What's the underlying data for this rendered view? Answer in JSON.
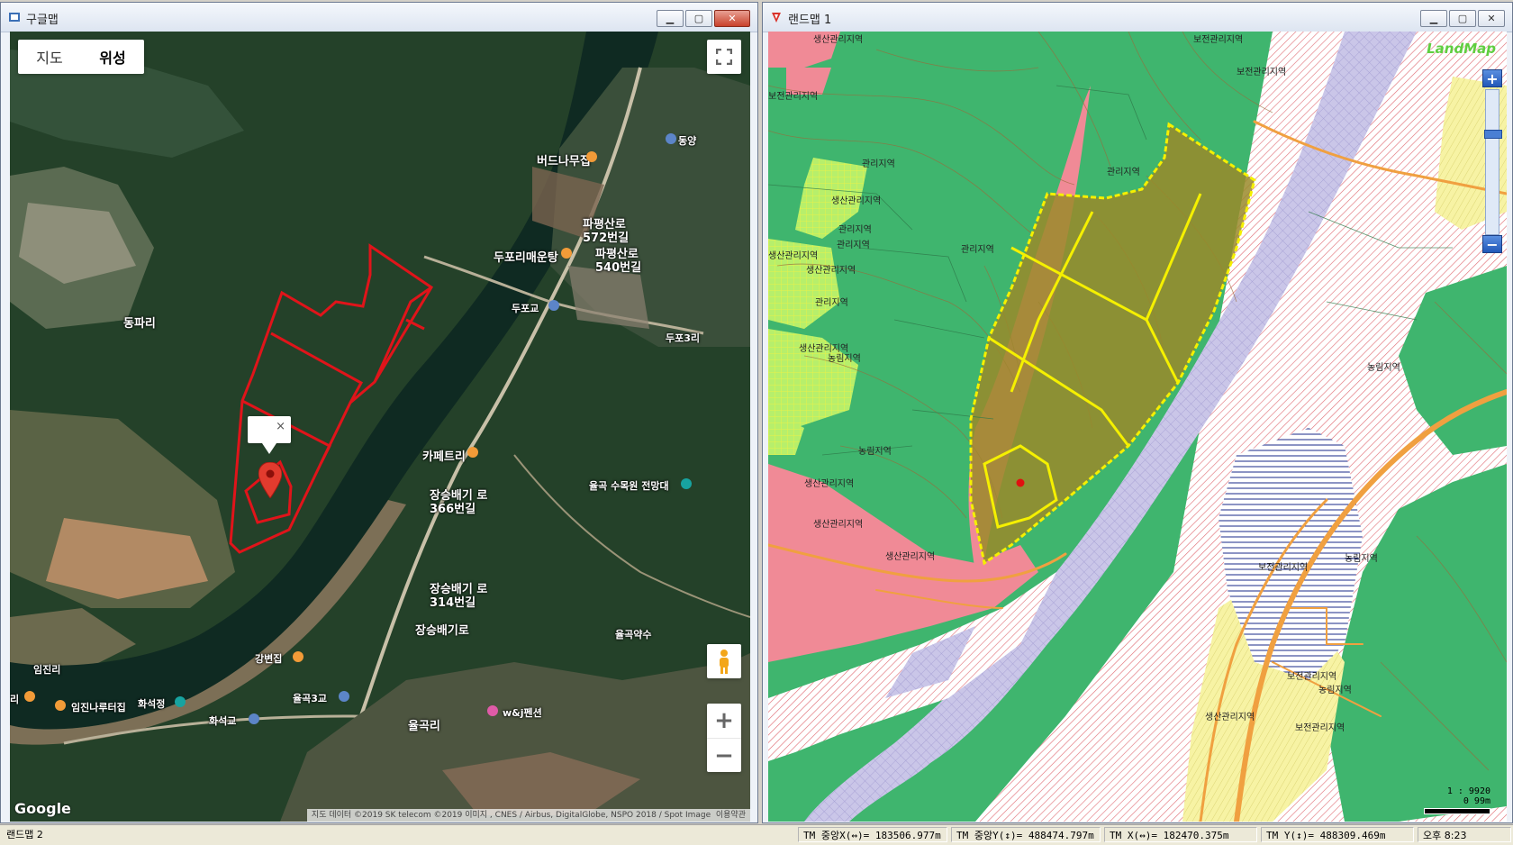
{
  "left_window": {
    "title": "구글맵",
    "map_type": {
      "map": "지도",
      "satellite": "위성"
    },
    "place_labels": [
      {
        "text": "동파리"
      },
      {
        "text": "버드나무집"
      },
      {
        "text": "파평산로 572번길"
      },
      {
        "text": "두포리매운탕"
      },
      {
        "text": "파평산로 540번길"
      },
      {
        "text": "두포교"
      },
      {
        "text": "두포3리"
      },
      {
        "text": "카페트리"
      },
      {
        "text": "율곡 수목원 전망대"
      },
      {
        "text": "장승배기 로366번길"
      },
      {
        "text": "장승배기 로314번길"
      },
      {
        "text": "장승배기로"
      },
      {
        "text": "율곡약수"
      },
      {
        "text": "강변집"
      },
      {
        "text": "임진리"
      },
      {
        "text": "리"
      },
      {
        "text": "임진나루터집"
      },
      {
        "text": "화석정"
      },
      {
        "text": "율곡3교"
      },
      {
        "text": "w&j펜션"
      },
      {
        "text": "화석교"
      },
      {
        "text": "율곡리"
      },
      {
        "text": "동양"
      }
    ],
    "google_logo": "Google",
    "attribution": "지도 데이터 ©2019 SK telecom ©2019 이미지 , CNES / Airbus, DigitalGlobe, NSPO 2018 / Spot Image",
    "terms": "이용약관",
    "zoom_in": "+",
    "zoom_out": "−",
    "infowindow_close": "×",
    "colors": {
      "water": "#0f2a22",
      "forest": "#1e3a24",
      "parcel": "#e0141a"
    }
  },
  "right_window": {
    "title": "랜드맵 1",
    "logo": "LandMap",
    "zone_labels": [
      {
        "text": "보전관리지역"
      },
      {
        "text": "보전관리지역"
      },
      {
        "text": "생산관리지역"
      },
      {
        "text": "보전관리지역"
      },
      {
        "text": "관리지역"
      },
      {
        "text": "생산관리지역"
      },
      {
        "text": "관리지역"
      },
      {
        "text": "관리지역"
      },
      {
        "text": "관리지역"
      },
      {
        "text": "관리지역"
      },
      {
        "text": "생산관리지역"
      },
      {
        "text": "관리지역"
      },
      {
        "text": "생산관리지역"
      },
      {
        "text": "생산관리지역"
      },
      {
        "text": "농림지역"
      },
      {
        "text": "농림지역"
      },
      {
        "text": "생산관리지역"
      },
      {
        "text": "생산관리지역"
      },
      {
        "text": "생산관리지역"
      },
      {
        "text": "농림지역"
      },
      {
        "text": "보전관리지역"
      },
      {
        "text": "보전관리지역"
      },
      {
        "text": "농림지역"
      },
      {
        "text": "생산관리지역"
      },
      {
        "text": "보전관리지역"
      },
      {
        "text": "농림지역"
      }
    ],
    "zoom_plus": "+",
    "zoom_minus": "−",
    "scale_ratio": "1 : 9920",
    "scale_dist": "0  99m",
    "colors": {
      "green": "#3fb56e",
      "pink": "#f08a96",
      "river": "#c9c4e8",
      "yellow_parcel": "#f5f000"
    }
  },
  "statusbar": {
    "title": "랜드맵 2",
    "tm_center_x": "TM 중앙X(↔)= 183506.977m",
    "tm_center_y": "TM 중앙Y(↕)= 488474.797m",
    "tm_x": "TM X(↔)= 182470.375m",
    "tm_y": "TM Y(↕)= 488309.469m",
    "time": "오후 8:23"
  }
}
